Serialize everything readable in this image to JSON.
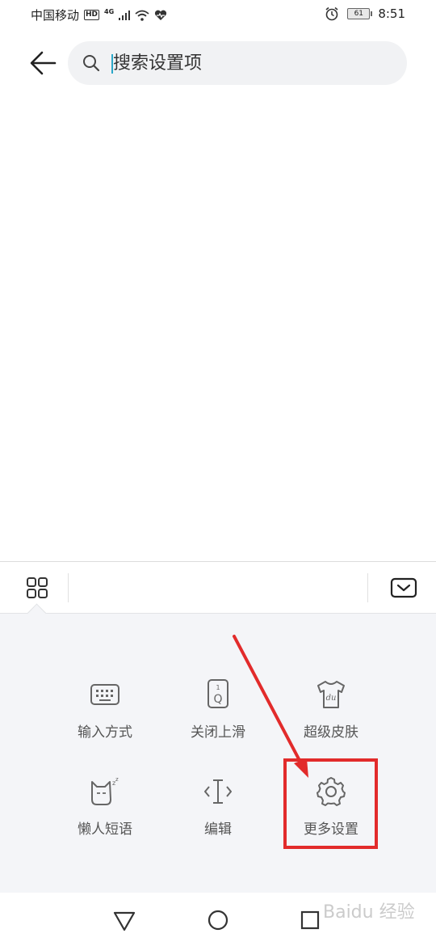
{
  "status_bar": {
    "carrier": "中国移动",
    "hd": "HD",
    "network": "4G",
    "battery": "61",
    "time": "8:51"
  },
  "search": {
    "placeholder": "搜索设置项"
  },
  "keyboard_menu": {
    "items": [
      {
        "label": "输入方式",
        "icon": "keyboard-icon"
      },
      {
        "label": "关闭上滑",
        "icon": "key-swipe-icon"
      },
      {
        "label": "超级皮肤",
        "icon": "tshirt-skin-icon"
      },
      {
        "label": "懒人短语",
        "icon": "sleeping-cat-icon"
      },
      {
        "label": "编辑",
        "icon": "text-cursor-icon"
      },
      {
        "label": "更多设置",
        "icon": "gear-icon"
      }
    ]
  },
  "annotation": {
    "highlight_color": "#e22b2b"
  },
  "watermark": "Baidu 经验"
}
